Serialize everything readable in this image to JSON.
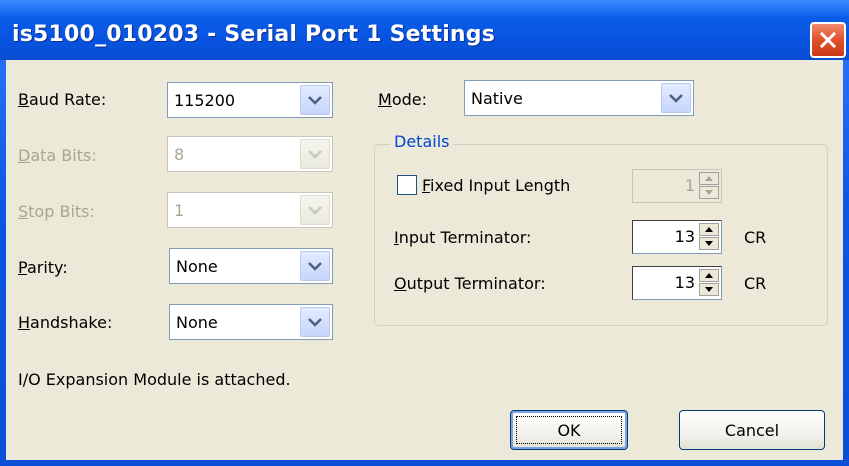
{
  "window": {
    "title": "is5100_010203 - Serial Port 1 Settings"
  },
  "left": {
    "baud_rate": {
      "label_u": "B",
      "label_rest": "aud Rate:",
      "value": "115200"
    },
    "data_bits": {
      "label_u": "D",
      "label_rest": "ata Bits:",
      "value": "8"
    },
    "stop_bits": {
      "label_u": "S",
      "label_rest": "top Bits:",
      "value": "1"
    },
    "parity": {
      "label_u": "P",
      "label_rest": "arity:",
      "value": "None"
    },
    "handshake": {
      "label_u": "H",
      "label_rest": "andshake:",
      "value": "None"
    },
    "status_text": "I/O Expansion Module is attached."
  },
  "right": {
    "mode": {
      "label_u": "M",
      "label_rest": "ode:",
      "value": "Native"
    },
    "details": {
      "title": "Details",
      "fixed_input_length": {
        "label_u": "F",
        "label_rest": "ixed Input Length",
        "checked": false,
        "value": "1"
      },
      "input_terminator": {
        "label_u": "I",
        "label_rest": "nput Terminator:",
        "value": "13",
        "suffix": "CR"
      },
      "output_terminator": {
        "label_u": "O",
        "label_rest": "utput Terminator:",
        "value": "13",
        "suffix": "CR"
      }
    }
  },
  "buttons": {
    "ok": "OK",
    "cancel": "Cancel"
  },
  "colors": {
    "titlebar": "#0a5ce8",
    "dialog_bg": "#ece9d8",
    "group_title": "#0046d5",
    "disabled_text": "#a7a695",
    "close_button": "#e0502a"
  }
}
